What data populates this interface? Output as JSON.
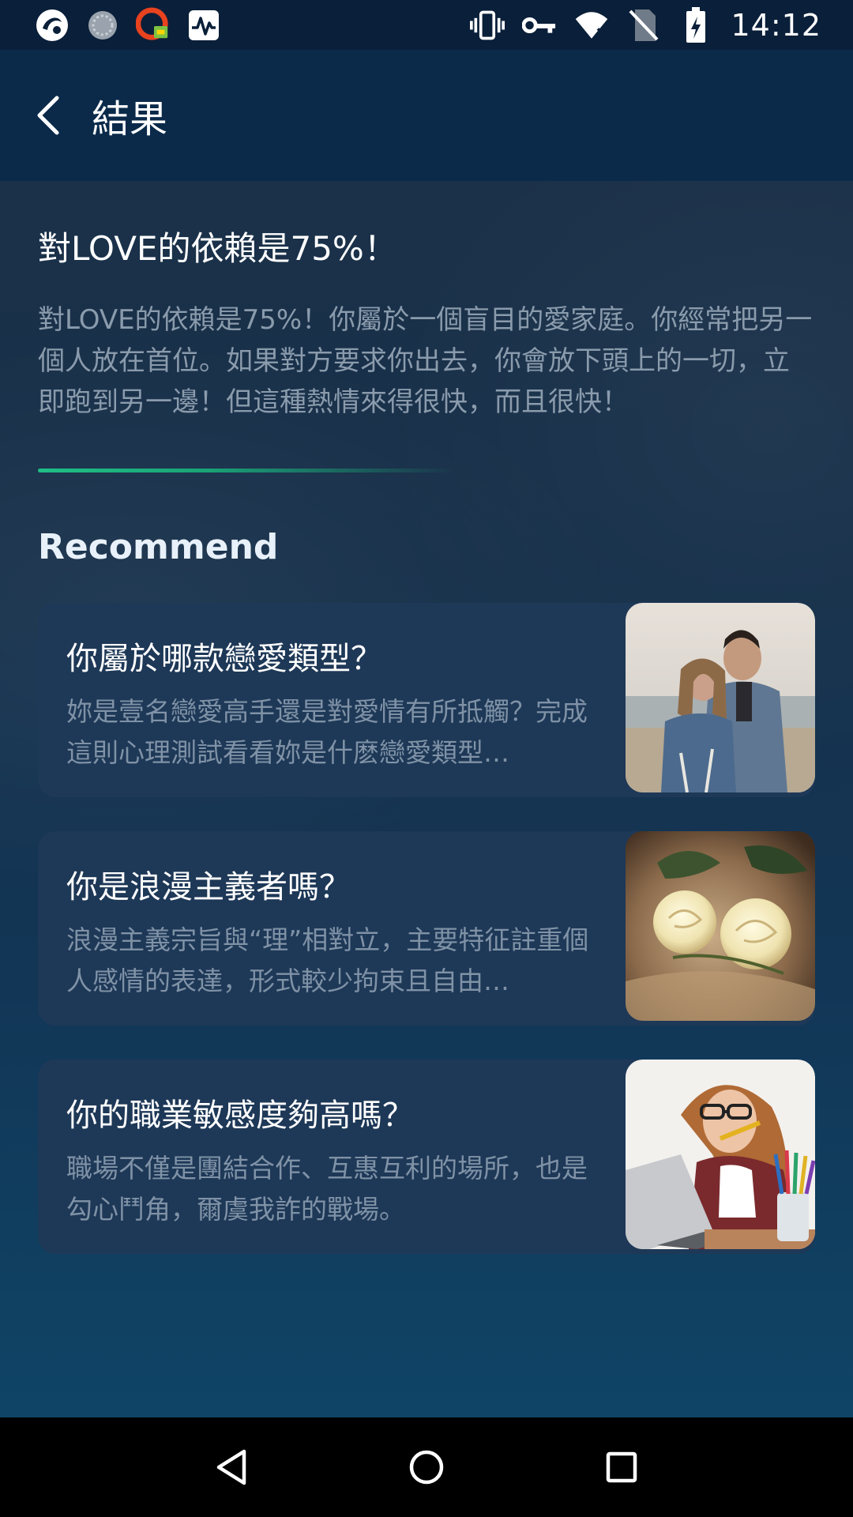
{
  "status_bar": {
    "time": "14:12",
    "left_icons": [
      "app-logo-icon",
      "loading-icon",
      "vpn-app-icon",
      "activity-monitor-icon"
    ],
    "right_icons": [
      "vibrate-icon",
      "vpn-key-icon",
      "wifi-icon",
      "no-sim-icon",
      "battery-charging-icon"
    ]
  },
  "app_bar": {
    "title": "結果"
  },
  "result": {
    "title": "對LOVE的依賴是75%！",
    "description": "對LOVE的依賴是75%！你屬於一個盲目的愛家庭。你經常把另一個人放在首位。如果對方要求你出去，你會放下頭上的一切，立即跑到另一邊！但這種熱情來得很快，而且很快！",
    "progress_fraction": 0.75
  },
  "recommend": {
    "title": "Recommend",
    "items": [
      {
        "title": "你屬於哪款戀愛類型？",
        "description": "妳是壹名戀愛高手還是對愛情有所抵觸？完成這則心理測試看看妳是什麽戀愛類型…",
        "image": "couple-photo"
      },
      {
        "title": "你是浪漫主義者嗎？",
        "description": "浪漫主義宗旨與“理”相對立，主要特征註重個人感情的表達，形式較少拘束且自由…",
        "image": "white-roses-photo"
      },
      {
        "title": "你的職業敏感度夠高嗎？",
        "description": "職場不僅是團結合作、互惠互利的場所，也是勾心鬥角，爾虞我詐的戰場。",
        "image": "woman-laptop-photo"
      }
    ]
  },
  "nav_bar": {
    "buttons": [
      "back-triangle-icon",
      "home-circle-icon",
      "recents-square-icon"
    ]
  },
  "colors": {
    "accent": "#1fbf86",
    "card_bg": "#1e3857",
    "app_bar_bg": "#0b2a4a"
  }
}
